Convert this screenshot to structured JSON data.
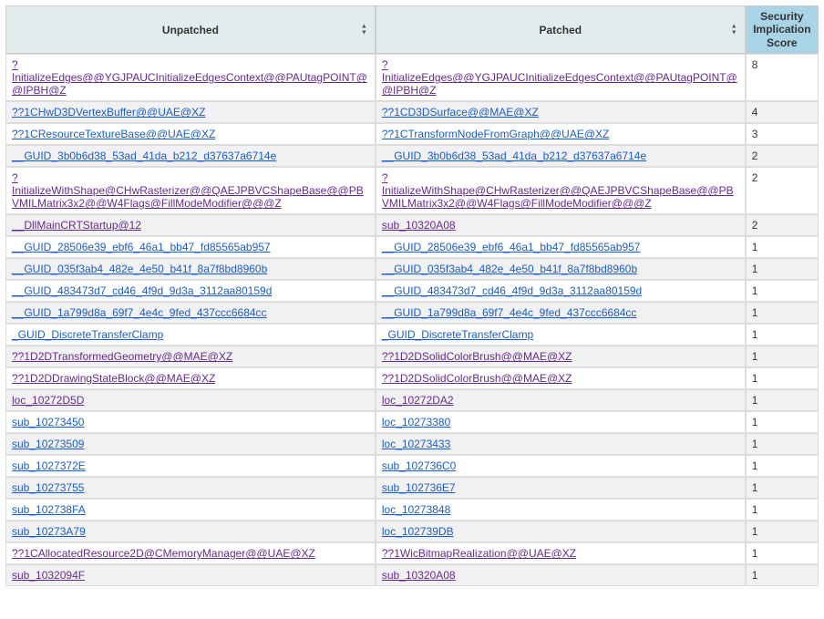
{
  "columns": {
    "unpatched": "Unpatched",
    "patched": "Patched",
    "score": "Security Implication Score"
  },
  "rows": [
    {
      "unpatched": "?InitializeEdges@@YGJPAUCInitializeEdgesContext@@PAUtagPOINT@@IPBH@Z",
      "u_vis": true,
      "patched": "?InitializeEdges@@YGJPAUCInitializeEdgesContext@@PAUtagPOINT@@IPBH@Z",
      "p_vis": true,
      "score": "8"
    },
    {
      "unpatched": "??1CHwD3DVertexBuffer@@UAE@XZ",
      "u_vis": false,
      "patched": "??1CD3DSurface@@MAE@XZ",
      "p_vis": false,
      "score": "4"
    },
    {
      "unpatched": "??1CResourceTextureBase@@UAE@XZ",
      "u_vis": false,
      "patched": "??1CTransformNodeFromGraph@@UAE@XZ",
      "p_vis": false,
      "score": "3"
    },
    {
      "unpatched": "__GUID_3b0b6d38_53ad_41da_b212_d37637a6714e",
      "u_vis": false,
      "patched": "__GUID_3b0b6d38_53ad_41da_b212_d37637a6714e",
      "p_vis": false,
      "score": "2"
    },
    {
      "unpatched": "?InitializeWithShape@CHwRasterizer@@QAEJPBVCShapeBase@@PBVMILMatrix3x2@@W4Flags@FillModeModifier@@@Z",
      "u_vis": true,
      "patched": "?InitializeWithShape@CHwRasterizer@@QAEJPBVCShapeBase@@PBVMILMatrix3x2@@W4Flags@FillModeModifier@@@Z",
      "p_vis": true,
      "score": "2"
    },
    {
      "unpatched": "__DllMainCRTStartup@12",
      "u_vis": true,
      "patched": "sub_10320A08",
      "p_vis": true,
      "score": "2"
    },
    {
      "unpatched": "__GUID_28506e39_ebf6_46a1_bb47_fd85565ab957",
      "u_vis": false,
      "patched": "__GUID_28506e39_ebf6_46a1_bb47_fd85565ab957",
      "p_vis": false,
      "score": "1"
    },
    {
      "unpatched": "__GUID_035f3ab4_482e_4e50_b41f_8a7f8bd8960b",
      "u_vis": false,
      "patched": "__GUID_035f3ab4_482e_4e50_b41f_8a7f8bd8960b",
      "p_vis": false,
      "score": "1"
    },
    {
      "unpatched": "__GUID_483473d7_cd46_4f9d_9d3a_3112aa80159d",
      "u_vis": false,
      "patched": "__GUID_483473d7_cd46_4f9d_9d3a_3112aa80159d",
      "p_vis": false,
      "score": "1"
    },
    {
      "unpatched": "__GUID_1a799d8a_69f7_4e4c_9fed_437ccc6684cc",
      "u_vis": false,
      "patched": "__GUID_1a799d8a_69f7_4e4c_9fed_437ccc6684cc",
      "p_vis": false,
      "score": "1"
    },
    {
      "unpatched": "_GUID_DiscreteTransferClamp",
      "u_vis": false,
      "patched": "_GUID_DiscreteTransferClamp",
      "p_vis": false,
      "score": "1"
    },
    {
      "unpatched": "??1D2DTransformedGeometry@@MAE@XZ",
      "u_vis": true,
      "patched": "??1D2DSolidColorBrush@@MAE@XZ",
      "p_vis": true,
      "score": "1"
    },
    {
      "unpatched": "??1D2DDrawingStateBlock@@MAE@XZ",
      "u_vis": true,
      "patched": "??1D2DSolidColorBrush@@MAE@XZ",
      "p_vis": true,
      "score": "1"
    },
    {
      "unpatched": "loc_10272D5D",
      "u_vis": true,
      "patched": "loc_10272DA2",
      "p_vis": true,
      "score": "1"
    },
    {
      "unpatched": "sub_10273450",
      "u_vis": false,
      "patched": "loc_10273380",
      "p_vis": false,
      "score": "1"
    },
    {
      "unpatched": "sub_10273509",
      "u_vis": false,
      "patched": "loc_10273433",
      "p_vis": false,
      "score": "1"
    },
    {
      "unpatched": "sub_1027372E",
      "u_vis": false,
      "patched": "sub_102736C0",
      "p_vis": false,
      "score": "1"
    },
    {
      "unpatched": "sub_10273755",
      "u_vis": false,
      "patched": "sub_102736E7",
      "p_vis": false,
      "score": "1"
    },
    {
      "unpatched": "sub_102738FA",
      "u_vis": false,
      "patched": "loc_10273848",
      "p_vis": false,
      "score": "1"
    },
    {
      "unpatched": "sub_10273A79",
      "u_vis": false,
      "patched": "loc_102739DB",
      "p_vis": false,
      "score": "1"
    },
    {
      "unpatched": "??1CAllocatedResource2D@CMemoryManager@@UAE@XZ",
      "u_vis": true,
      "patched": "??1WicBitmapRealization@@UAE@XZ",
      "p_vis": true,
      "score": "1"
    },
    {
      "unpatched": "sub_1032094F",
      "u_vis": true,
      "patched": "sub_10320A08",
      "p_vis": true,
      "score": "1"
    }
  ]
}
